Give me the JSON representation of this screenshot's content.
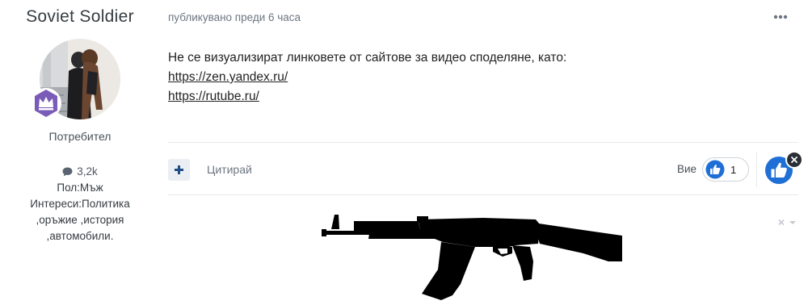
{
  "author": {
    "name": "Soviet Soldier",
    "role": "Потребител",
    "post_count": "3,2k",
    "gender": "Пол:Мъж",
    "interests_line1": "Интереси:Политика",
    "interests_line2": ",оръжие ,история",
    "interests_line3": ",автомобили.",
    "avatar_icon": "user-photo",
    "badge_icon": "crown-icon"
  },
  "post": {
    "meta": "публикувано преди 6 часа",
    "text": "Не се визуализират линковете от сайтове за видео споделяне, като:",
    "links": [
      "https://zen.yandex.ru/",
      "https://rutube.ru/"
    ]
  },
  "actions": {
    "quote_label": "Цитирай",
    "you_label": "Вие",
    "reaction_count": "1"
  },
  "colors": {
    "accent": "#1f6fd6",
    "divider": "#e7e9ec"
  }
}
